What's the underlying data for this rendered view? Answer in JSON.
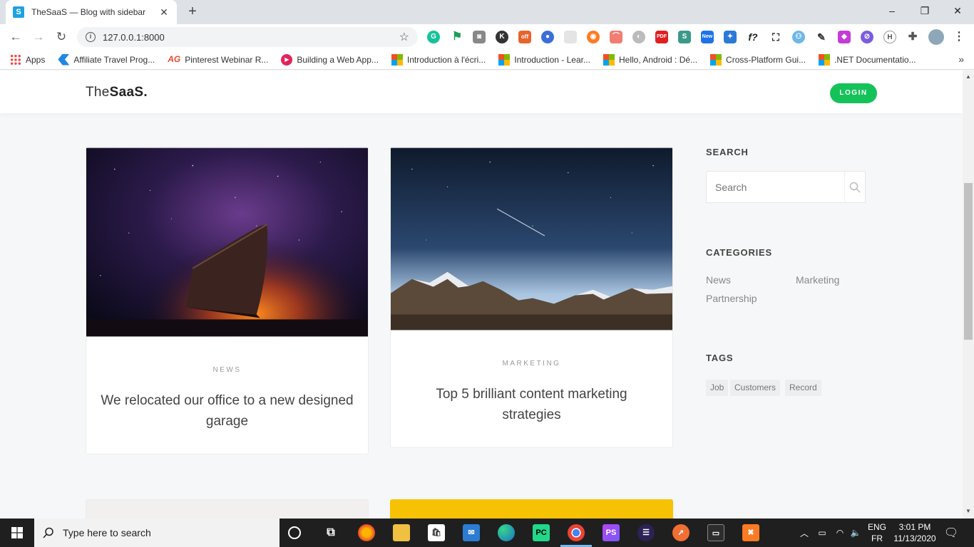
{
  "browser": {
    "tab_title": "TheSaaS — Blog with sidebar",
    "tab_favicon": "S",
    "url": "127.0.0.1:8000"
  },
  "bookmarks": [
    {
      "label": "Apps",
      "icon": "apps-grid-icon"
    },
    {
      "label": "Affiliate Travel Prog...",
      "icon": "travel-icon"
    },
    {
      "label": "Pinterest Webinar R...",
      "icon": "ag-icon"
    },
    {
      "label": "Building a Web App...",
      "icon": "play-icon"
    },
    {
      "label": "Introduction à l'écri...",
      "icon": "microsoft-icon"
    },
    {
      "label": "Introduction - Lear...",
      "icon": "microsoft-icon"
    },
    {
      "label": "Hello, Android : Dé...",
      "icon": "microsoft-icon"
    },
    {
      "label": "Cross-Platform Gui...",
      "icon": "microsoft-icon"
    },
    {
      "label": ".NET Documentatio...",
      "icon": "microsoft-icon"
    }
  ],
  "extensions": {
    "off_badge": "off",
    "new_badge": "New",
    "pdf_badge": "PDF",
    "s_badge": "S",
    "f_badge": "f?",
    "ps_badge": "PS",
    "h_badge": "H"
  },
  "site": {
    "logo_light": "The",
    "logo_bold": "SaaS.",
    "login_label": "LOGIN"
  },
  "posts": [
    {
      "category": "NEWS",
      "title": "We relocated our office to a new designed garage"
    },
    {
      "category": "MARKETING",
      "title": "Top 5 brilliant content marketing strategies"
    }
  ],
  "sidebar": {
    "search_heading": "SEARCH",
    "search_placeholder": "Search",
    "categories_heading": "CATEGORIES",
    "categories": [
      "News",
      "Marketing",
      "Partnership"
    ],
    "tags_heading": "TAGS",
    "tags": [
      "Job",
      "Customers",
      "Record"
    ]
  },
  "taskbar": {
    "search_placeholder": "Type here to search",
    "lang_top": "ENG",
    "lang_bottom": "FR",
    "time": "3:01 PM",
    "date": "11/13/2020",
    "pycharm_label": "PC",
    "phpstorm_label": "PS"
  },
  "colors": {
    "accent_green": "#15c25a",
    "card4_yellow": "#f7c204"
  }
}
